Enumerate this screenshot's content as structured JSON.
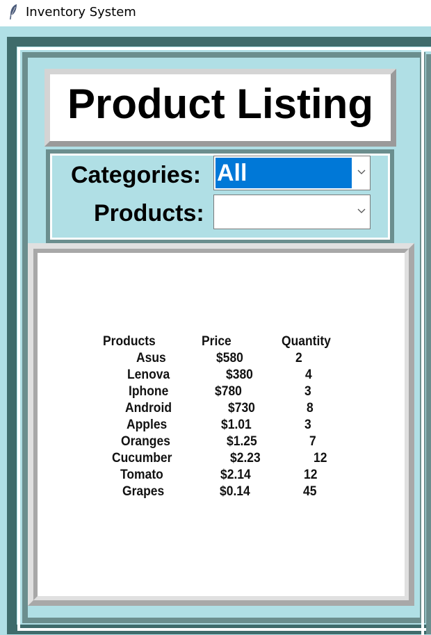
{
  "window": {
    "title": "Inventory System",
    "icon": "feather-icon"
  },
  "header": {
    "title": "Product Listing"
  },
  "filters": {
    "categories_label": "Categories:",
    "categories_value": "All",
    "products_label": "Products:",
    "products_value": ""
  },
  "table": {
    "headers": [
      "Products",
      "Price",
      "Quantity"
    ],
    "rows": [
      {
        "product": "Asus",
        "price": "$580",
        "quantity": "2"
      },
      {
        "product": "Lenova",
        "price": "$380",
        "quantity": "4"
      },
      {
        "product": "Iphone",
        "price": "$780",
        "quantity": "3"
      },
      {
        "product": "Android",
        "price": "$730",
        "quantity": "8"
      },
      {
        "product": "Apples",
        "price": "$1.01",
        "quantity": "3"
      },
      {
        "product": "Oranges",
        "price": "$1.25",
        "quantity": "7"
      },
      {
        "product": "Cucumber",
        "price": "$2.23",
        "quantity": "12"
      },
      {
        "product": "Tomato",
        "price": "$2.14",
        "quantity": "12"
      },
      {
        "product": "Grapes",
        "price": "$0.14",
        "quantity": "45"
      }
    ]
  },
  "colors": {
    "background": "#b0dfe5",
    "frame_dark": "#3f6b6b",
    "frame_mid": "#6b8e8e",
    "selection": "#0078d7"
  }
}
